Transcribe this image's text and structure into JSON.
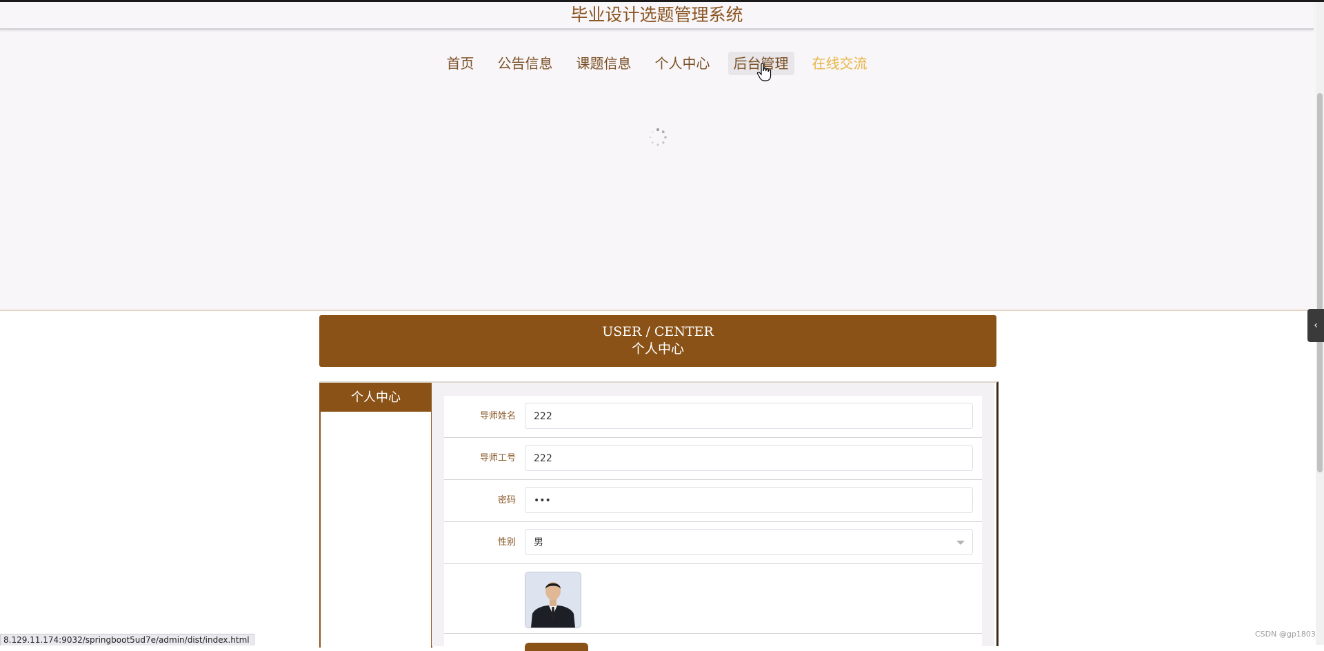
{
  "header": {
    "title": "毕业设计选题管理系统"
  },
  "nav": {
    "items": [
      {
        "label": "首页"
      },
      {
        "label": "公告信息"
      },
      {
        "label": "课题信息"
      },
      {
        "label": "个人中心"
      },
      {
        "label": "后台管理"
      },
      {
        "label": "在线交流"
      }
    ],
    "hovered": "后台管理",
    "active": "在线交流"
  },
  "banner": {
    "en": "USER / CENTER",
    "cn": "个人中心"
  },
  "sidebar": {
    "title": "个人中心"
  },
  "form": {
    "fields": [
      {
        "label": "导师姓名",
        "value": "222"
      },
      {
        "label": "导师工号",
        "value": "222"
      },
      {
        "label": "密码",
        "value": "•••"
      },
      {
        "label": "性别",
        "value": "男"
      }
    ]
  },
  "status_bar": {
    "url": "8.129.11.174:9032/springboot5ud7e/admin/dist/index.html"
  },
  "watermark": "CSDN @gp1803",
  "colors": {
    "brand": "#8a5216",
    "nav_active": "#e9b544",
    "title": "#8a5522"
  }
}
